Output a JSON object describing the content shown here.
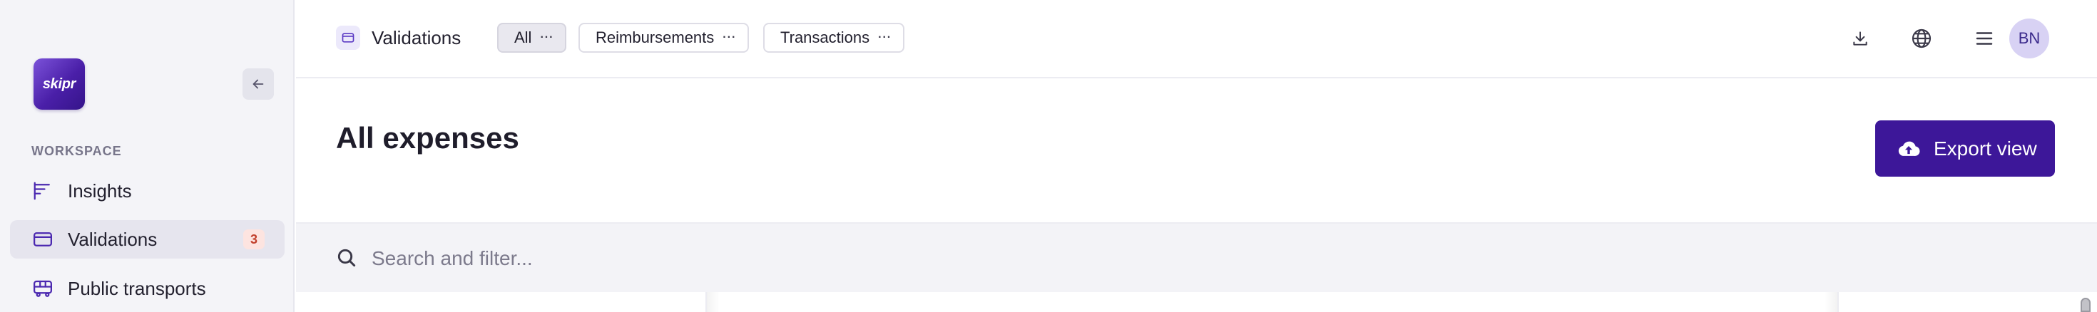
{
  "app": {
    "logo_text": "skipr",
    "brand_color": "#3d1799"
  },
  "sidebar": {
    "section_label": "WORKSPACE",
    "items": [
      {
        "label": "Insights",
        "icon": "chart-bars-icon",
        "active": false
      },
      {
        "label": "Validations",
        "icon": "card-icon",
        "active": true,
        "count": "3"
      },
      {
        "label": "Public transports",
        "icon": "bus-icon",
        "active": false
      }
    ]
  },
  "topbar": {
    "breadcrumb": "Validations",
    "chips": [
      {
        "label": "All",
        "active": true
      },
      {
        "label": "Reimbursements",
        "active": false
      },
      {
        "label": "Transactions",
        "active": false
      }
    ],
    "more_glyph": "···",
    "avatar_initials": "BN"
  },
  "main": {
    "title": "All expenses",
    "export_label": "Export view"
  },
  "search": {
    "placeholder": "Search and filter..."
  }
}
